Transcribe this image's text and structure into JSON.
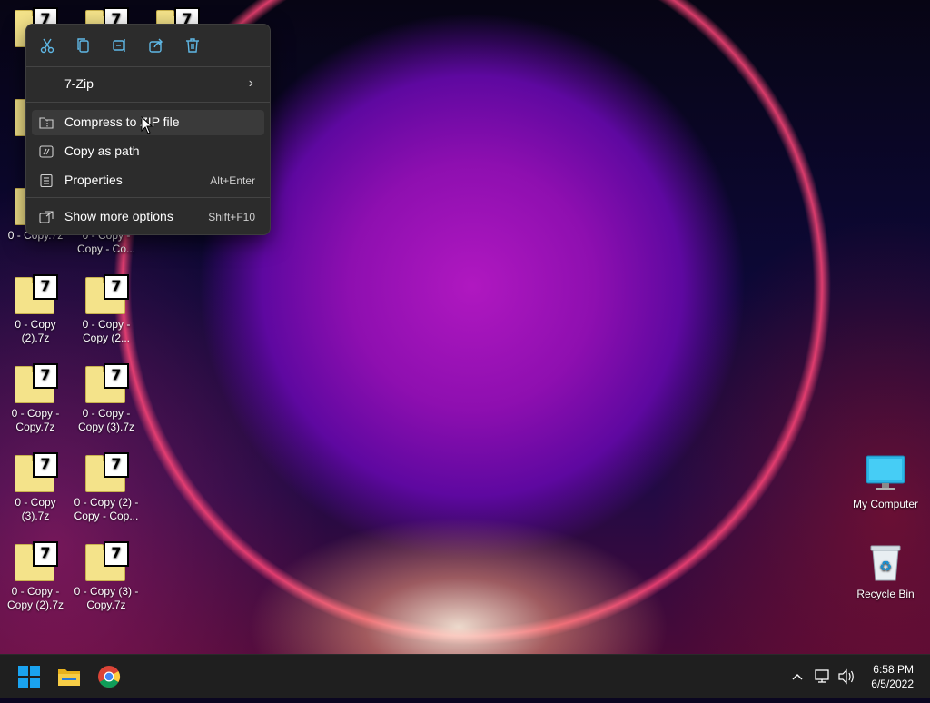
{
  "desktop_icons": [
    {
      "label_lines": [
        "0 -",
        "Cop"
      ]
    },
    {
      "label_lines": [
        "0 - Copy.7z"
      ]
    },
    {
      "label_lines": [
        "0 - Copy -",
        "Copy - Co..."
      ]
    },
    {
      "label_lines": [
        "0 - Copy",
        "(2).7z"
      ]
    },
    {
      "label_lines": [
        "0 - Copy -",
        "Copy (2..."
      ]
    },
    {
      "label_lines": [
        "0 - Copy -",
        "Copy.7z"
      ]
    },
    {
      "label_lines": [
        "0 - Copy -",
        "Copy (3).7z"
      ]
    },
    {
      "label_lines": [
        "0 - Copy",
        "(3).7z"
      ]
    },
    {
      "label_lines": [
        "0 - Copy (2) -",
        "Copy - Cop..."
      ]
    },
    {
      "label_lines": [
        "0 - Copy -",
        "Copy (2).7z"
      ]
    },
    {
      "label_lines": [
        "0 - Copy (3) -",
        "Copy.7z"
      ]
    }
  ],
  "zip_badge": "7",
  "system_icons": {
    "my_computer": "My Computer",
    "recycle_bin": "Recycle Bin"
  },
  "context_menu": {
    "toolbar": [
      "cut-icon",
      "copy-icon",
      "rename-icon",
      "share-icon",
      "delete-icon"
    ],
    "items": {
      "seven_zip": "7-Zip",
      "compress_zip": "Compress to ZIP file",
      "copy_path": "Copy as path",
      "properties": "Properties",
      "properties_shortcut": "Alt+Enter",
      "show_more": "Show more options",
      "show_more_shortcut": "Shift+F10"
    },
    "hovered_item": "Compress to ZIP file"
  },
  "taskbar": {
    "apps": [
      "start-button",
      "file-explorer",
      "chrome"
    ],
    "time": "6:58 PM",
    "date": "6/5/2022"
  },
  "colors": {
    "menu_bg": "#2c2c2c",
    "taskbar_bg": "#1f1f1f",
    "accent_blue": "#1aa3f0"
  }
}
